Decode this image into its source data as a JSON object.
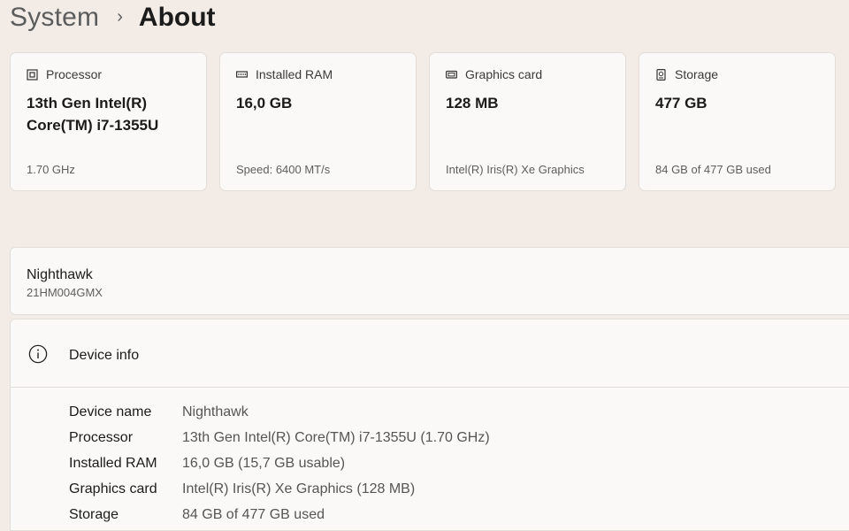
{
  "breadcrumb": {
    "parent": "System",
    "separator": "›",
    "current": "About"
  },
  "cards": [
    {
      "icon": "processor-icon",
      "title": "Processor",
      "value": "13th Gen Intel(R) Core(TM) i7-1355U",
      "sub": "1.70 GHz"
    },
    {
      "icon": "ram-icon",
      "title": "Installed RAM",
      "value": "16,0 GB",
      "sub": "Speed: 6400 MT/s"
    },
    {
      "icon": "graphics-card-icon",
      "title": "Graphics card",
      "value": "128 MB",
      "sub": "Intel(R) Iris(R) Xe Graphics"
    },
    {
      "icon": "storage-icon",
      "title": "Storage",
      "value": "477 GB",
      "sub": "84 GB of 477 GB used"
    }
  ],
  "device": {
    "name": "Nighthawk",
    "model": "21HM004GMX"
  },
  "device_info": {
    "title": "Device info",
    "rows": [
      {
        "label": "Device name",
        "value": "Nighthawk"
      },
      {
        "label": "Processor",
        "value": "13th Gen Intel(R) Core(TM) i7-1355U (1.70 GHz)"
      },
      {
        "label": "Installed RAM",
        "value": "16,0 GB (15,7 GB usable)"
      },
      {
        "label": "Graphics card",
        "value": "Intel(R) Iris(R) Xe Graphics (128 MB)"
      },
      {
        "label": "Storage",
        "value": "84 GB of 477 GB used"
      }
    ]
  }
}
